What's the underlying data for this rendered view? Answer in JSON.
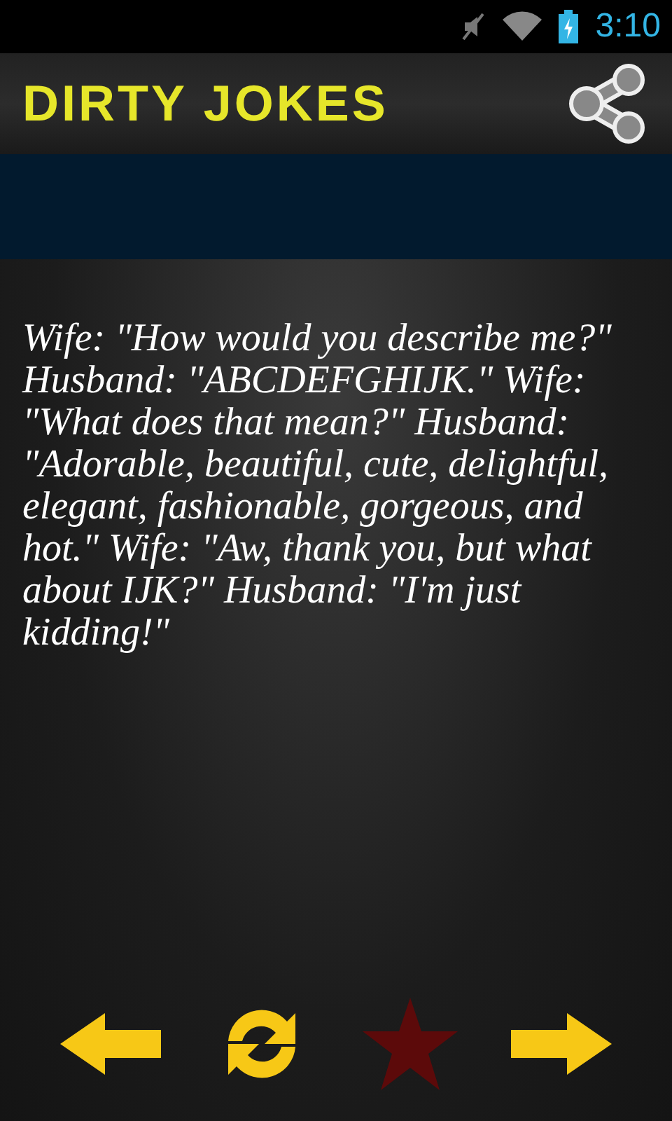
{
  "status_bar": {
    "time": "3:10"
  },
  "app_bar": {
    "title": "DIRTY JOKES"
  },
  "joke": {
    "text": "Wife: \"How would you describe me?\" Husband: \"ABCDEFGHIJK.\" Wife: \"What does that mean?\" Husband: \"Adorable, beautiful, cute, delightful, elegant, fashionable, gorgeous, and hot.\" Wife: \"Aw, thank you, but what about IJK?\" Husband: \"I'm just kidding!\""
  },
  "controls": {
    "favorite": false
  }
}
